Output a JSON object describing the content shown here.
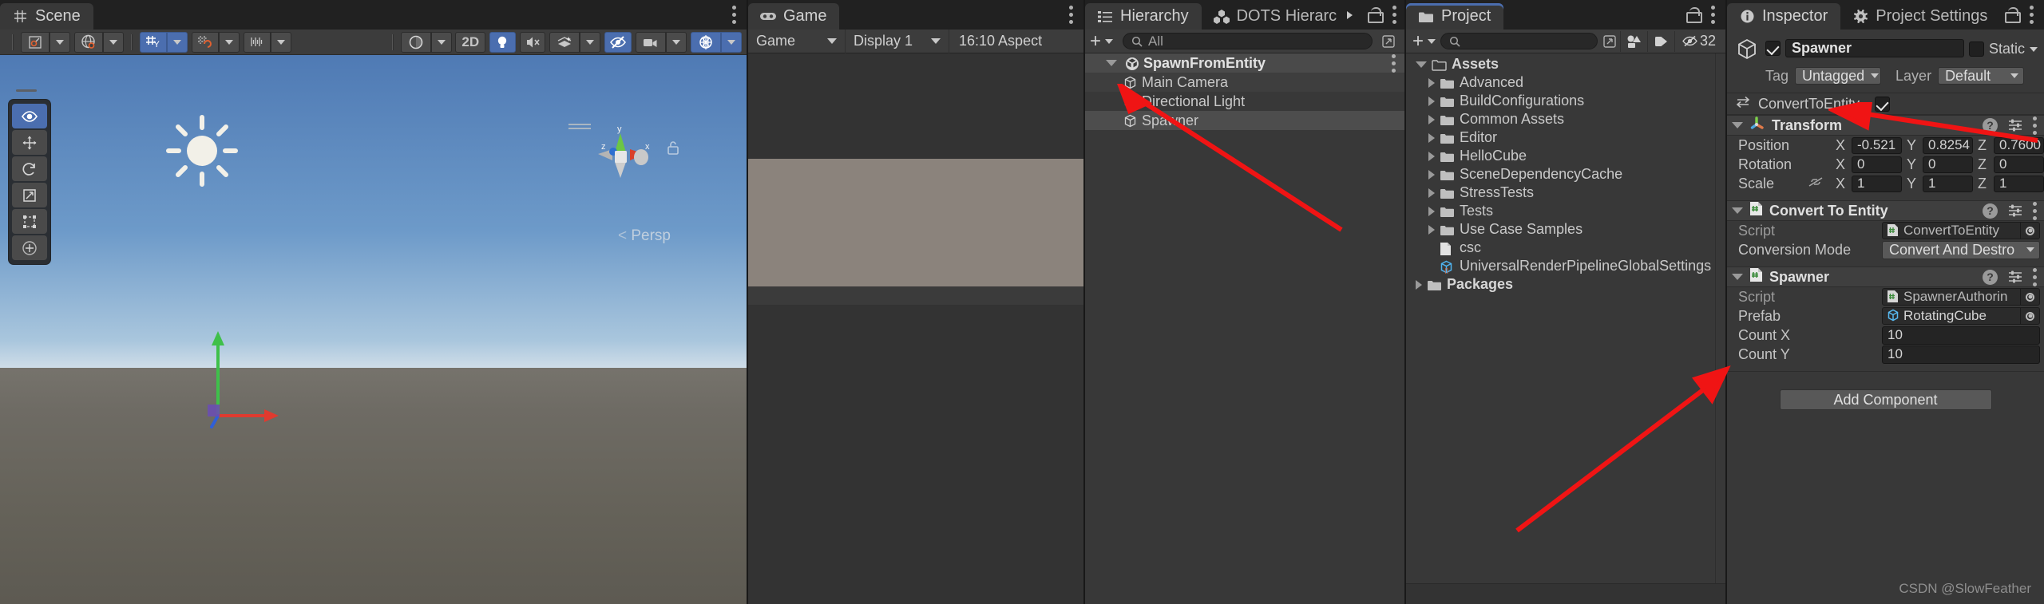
{
  "scene": {
    "tab_label": "Scene",
    "tab_icon": "grid-icon",
    "toolbar": {
      "pivot_mode": "pivot-center-icon",
      "handle_space": "global-handle-icon",
      "grid_snap": "grid-snap-icon",
      "surface_snap": "surface-snap-icon",
      "grid_visual": "grid-size-icon",
      "shading_mode": "shaded-icon",
      "two_d_label": "2D",
      "lighting": "light-bulb-icon",
      "audio": "audio-mute-icon",
      "fx": "effects-icon",
      "hidden_objects": "eye-off-icon",
      "camera": "camera-icon",
      "gizmos": "gizmos-globe-icon"
    },
    "tools": [
      "view-hand-tool",
      "move-tool",
      "rotate-tool",
      "scale-tool",
      "rect-tool",
      "transform-tool"
    ],
    "gizmo": {
      "axis_y": "y",
      "axis_x": "x",
      "axis_z": "z",
      "projection_label": "Persp"
    }
  },
  "game": {
    "tab_label": "Game",
    "tab_icon": "gamepad-icon",
    "toolbar": {
      "view_mode": "Game",
      "display": "Display 1",
      "aspect": "16:10 Aspect"
    }
  },
  "hierarchy": {
    "tab_label": "Hierarchy",
    "tab_icon": "hierarchy-list-icon",
    "tab2_label": "DOTS Hierarc",
    "tab2_icon": "dots-hexagons-icon",
    "toolbar": {
      "create_label": "+",
      "search_placeholder": "All",
      "search_value": ""
    },
    "items": [
      {
        "label": "SpawnFromEntity",
        "depth": 0,
        "icon": "unity-scene-icon",
        "expanded": true,
        "selected": false,
        "bold": true
      },
      {
        "label": "Main Camera",
        "depth": 1,
        "icon": "game-object-cube-icon",
        "selected": false,
        "bold": false
      },
      {
        "label": "Directional Light",
        "depth": 1,
        "icon": "game-object-cube-icon",
        "selected": false,
        "bold": false
      },
      {
        "label": "Spawner",
        "depth": 1,
        "icon": "game-object-cube-icon",
        "selected": true,
        "bold": false
      }
    ]
  },
  "project": {
    "tab_label": "Project",
    "tab_icon": "folder-icon",
    "toolbar": {
      "create_label": "+",
      "search_placeholder": "",
      "search_value": "",
      "filter_type_icon": "type-filter-icon",
      "filter_label_icon": "label-tag-icon",
      "hidden_count": "32",
      "hidden_icon": "eye-off-icon"
    },
    "items": [
      {
        "label": "Assets",
        "depth": 0,
        "icon": "folder-open-icon",
        "expandable": true,
        "expanded": true,
        "bold": true
      },
      {
        "label": "Advanced",
        "depth": 1,
        "icon": "folder-icon",
        "expandable": true,
        "expanded": false,
        "bold": false
      },
      {
        "label": "BuildConfigurations",
        "depth": 1,
        "icon": "folder-icon",
        "expandable": true,
        "expanded": false,
        "bold": false
      },
      {
        "label": "Common Assets",
        "depth": 1,
        "icon": "folder-icon",
        "expandable": true,
        "expanded": false,
        "bold": false
      },
      {
        "label": "Editor",
        "depth": 1,
        "icon": "folder-icon",
        "expandable": true,
        "expanded": false,
        "bold": false
      },
      {
        "label": "HelloCube",
        "depth": 1,
        "icon": "folder-icon",
        "expandable": true,
        "expanded": false,
        "bold": false
      },
      {
        "label": "SceneDependencyCache",
        "depth": 1,
        "icon": "folder-icon",
        "expandable": true,
        "expanded": false,
        "bold": false
      },
      {
        "label": "StressTests",
        "depth": 1,
        "icon": "folder-icon",
        "expandable": true,
        "expanded": false,
        "bold": false
      },
      {
        "label": "Tests",
        "depth": 1,
        "icon": "folder-icon",
        "expandable": true,
        "expanded": false,
        "bold": false
      },
      {
        "label": "Use Case Samples",
        "depth": 1,
        "icon": "folder-icon",
        "expandable": true,
        "expanded": false,
        "bold": false
      },
      {
        "label": "csc",
        "depth": 1,
        "icon": "text-file-icon",
        "expandable": false,
        "expanded": false,
        "bold": false
      },
      {
        "label": "UniversalRenderPipelineGlobalSettings",
        "depth": 1,
        "icon": "scriptable-object-icon",
        "expandable": false,
        "expanded": false,
        "bold": false
      },
      {
        "label": "Packages",
        "depth": 0,
        "icon": "folder-icon",
        "expandable": true,
        "expanded": false,
        "bold": true
      }
    ]
  },
  "inspector": {
    "tab_label": "Inspector",
    "tab_icon": "info-circle-icon",
    "tab2_label": "Project Settings",
    "tab2_icon": "gear-icon",
    "object": {
      "enabled": true,
      "name": "Spawner",
      "static_label": "Static",
      "static_checked": false,
      "tag_label": "Tag",
      "tag_value": "Untagged",
      "layer_label": "Layer",
      "layer_value": "Default"
    },
    "convert_to_entity_toggle": {
      "label": "ConvertToEntity",
      "icon": "convert-arrows-icon",
      "checked": true
    },
    "components": [
      {
        "name": "Transform",
        "icon": "transform-axes-icon",
        "expanded": true,
        "vector_rows": [
          {
            "label": "Position",
            "x": "-0.521",
            "y": "0.8254",
            "z": "0.7600"
          },
          {
            "label": "Rotation",
            "x": "0",
            "y": "0",
            "z": "0"
          },
          {
            "label": "Scale",
            "x": "1",
            "y": "1",
            "z": "1",
            "link_icon": "constrain-proportions-off-icon"
          }
        ]
      },
      {
        "name": "Convert To Entity",
        "icon": "csharp-script-icon",
        "expanded": true,
        "fields": [
          {
            "label": "Script",
            "type": "object",
            "value": "ConvertToEntity",
            "value_icon": "csharp-script-icon",
            "dim": true
          },
          {
            "label": "Conversion Mode",
            "type": "popup",
            "value": "Convert And Destro"
          }
        ]
      },
      {
        "name": "Spawner",
        "icon": "csharp-script-icon",
        "expanded": true,
        "fields": [
          {
            "label": "Script",
            "type": "object",
            "value": "SpawnerAuthorin",
            "value_icon": "csharp-script-icon",
            "dim": true
          },
          {
            "label": "Prefab",
            "type": "object",
            "value": "RotatingCube",
            "value_icon": "prefab-cube-icon",
            "dim": false
          },
          {
            "label": "Count X",
            "type": "text",
            "value": "10"
          },
          {
            "label": "Count Y",
            "type": "text",
            "value": "10"
          }
        ]
      }
    ],
    "add_component_label": "Add Component"
  },
  "watermark": "CSDN @SlowFeather",
  "colors": {
    "accent_blue": "#4b6eaf",
    "panel_bg": "#383838",
    "toolbar_bg": "#3c3c3c",
    "annotation_red": "#f01414"
  }
}
